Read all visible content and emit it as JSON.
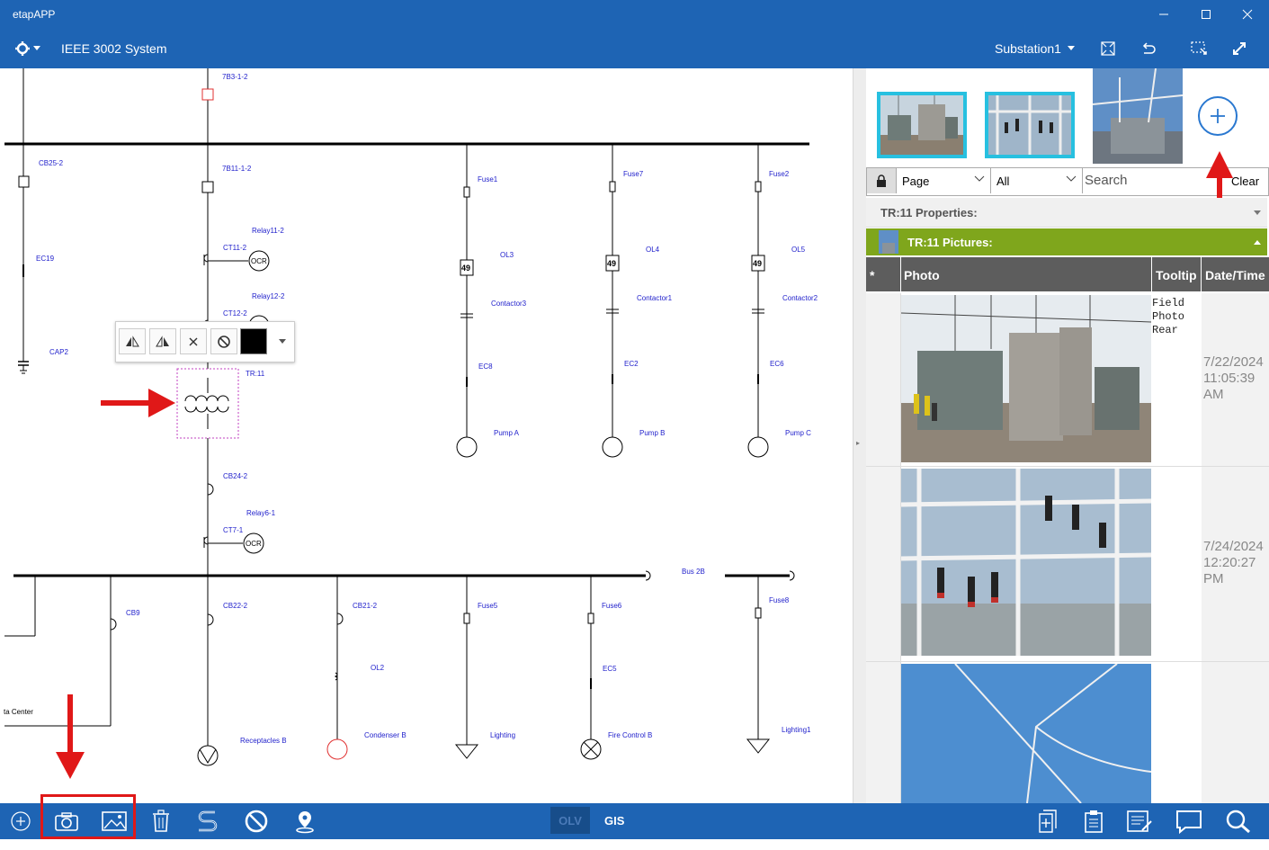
{
  "app": {
    "title": "etapAPP"
  },
  "toolbar": {
    "project_name": "IEEE 3002 System",
    "page_selector": "Substation1"
  },
  "diagram": {
    "labels": {
      "sw_7b3": "7B3-1-2",
      "sw_7b11": "7B11-1-2",
      "cb25": "CB25-2",
      "ec19": "EC19",
      "cap2": "CAP2",
      "relay11": "Relay11-2",
      "ct11": "CT11-2",
      "relay12": "Relay12-2",
      "ct12": "CT12-2",
      "tr11": "TR:11",
      "cb24": "CB24-2",
      "relay6": "Relay6-1",
      "ct7": "CT7-1",
      "fuse1": "Fuse1",
      "fuse7": "Fuse7",
      "fuse2": "Fuse2",
      "ol3": "OL3",
      "ol4": "OL4",
      "ol5": "OL5",
      "contactor3": "Contactor3",
      "contactor1": "Contactor1",
      "contactor2": "Contactor2",
      "ec8": "EC8",
      "ec2": "EC2",
      "ec6": "EC6",
      "pump_a": "Pump A",
      "pump_b": "Pump B",
      "pump_c": "Pump C",
      "bus2b": "Bus 2B",
      "cb9": "CB9",
      "cb22": "CB22-2",
      "cb21": "CB21-2",
      "fuse5": "Fuse5",
      "fuse6": "Fuse6",
      "fuse8": "Fuse8",
      "ol2": "OL2",
      "ec5": "EC5",
      "data_center": "ta Center",
      "receptacles_b": "Receptacles B",
      "condenser_b": "Condenser B",
      "lighting": "Lighting",
      "fire_control_b": "Fire Control B",
      "lighting1": "Lighting1",
      "ocr": "OCR",
      "ol_code": "49"
    }
  },
  "panel": {
    "filters": {
      "page": "Page",
      "all": "All",
      "search_placeholder": "Search",
      "clear": "Clear"
    },
    "properties_header": "TR:11 Properties:",
    "pictures_header": "TR:11 Pictures:",
    "table": {
      "columns": [
        "*",
        "Photo",
        "Tooltip",
        "Date/Time"
      ],
      "rows": [
        {
          "tooltip_lines": [
            "Field",
            "Photo",
            "Rear"
          ],
          "date_lines": [
            "7/22/2024",
            "11:05:39",
            "AM"
          ]
        },
        {
          "tooltip_lines": [
            "",
            "",
            ""
          ],
          "date_lines": [
            "7/24/2024",
            "12:20:27",
            "PM"
          ]
        },
        {
          "tooltip_lines": [
            "",
            "",
            ""
          ],
          "date_lines": [
            "",
            "",
            ""
          ]
        }
      ]
    }
  },
  "bottombar": {
    "olv": "OLV",
    "gis": "GIS"
  },
  "colors": {
    "brand_blue": "#1e64b4",
    "accent_green": "#7fa61c",
    "annotation_red": "#e01818",
    "label_blue": "#2222cc",
    "thumb_border": "#27c0e0"
  }
}
